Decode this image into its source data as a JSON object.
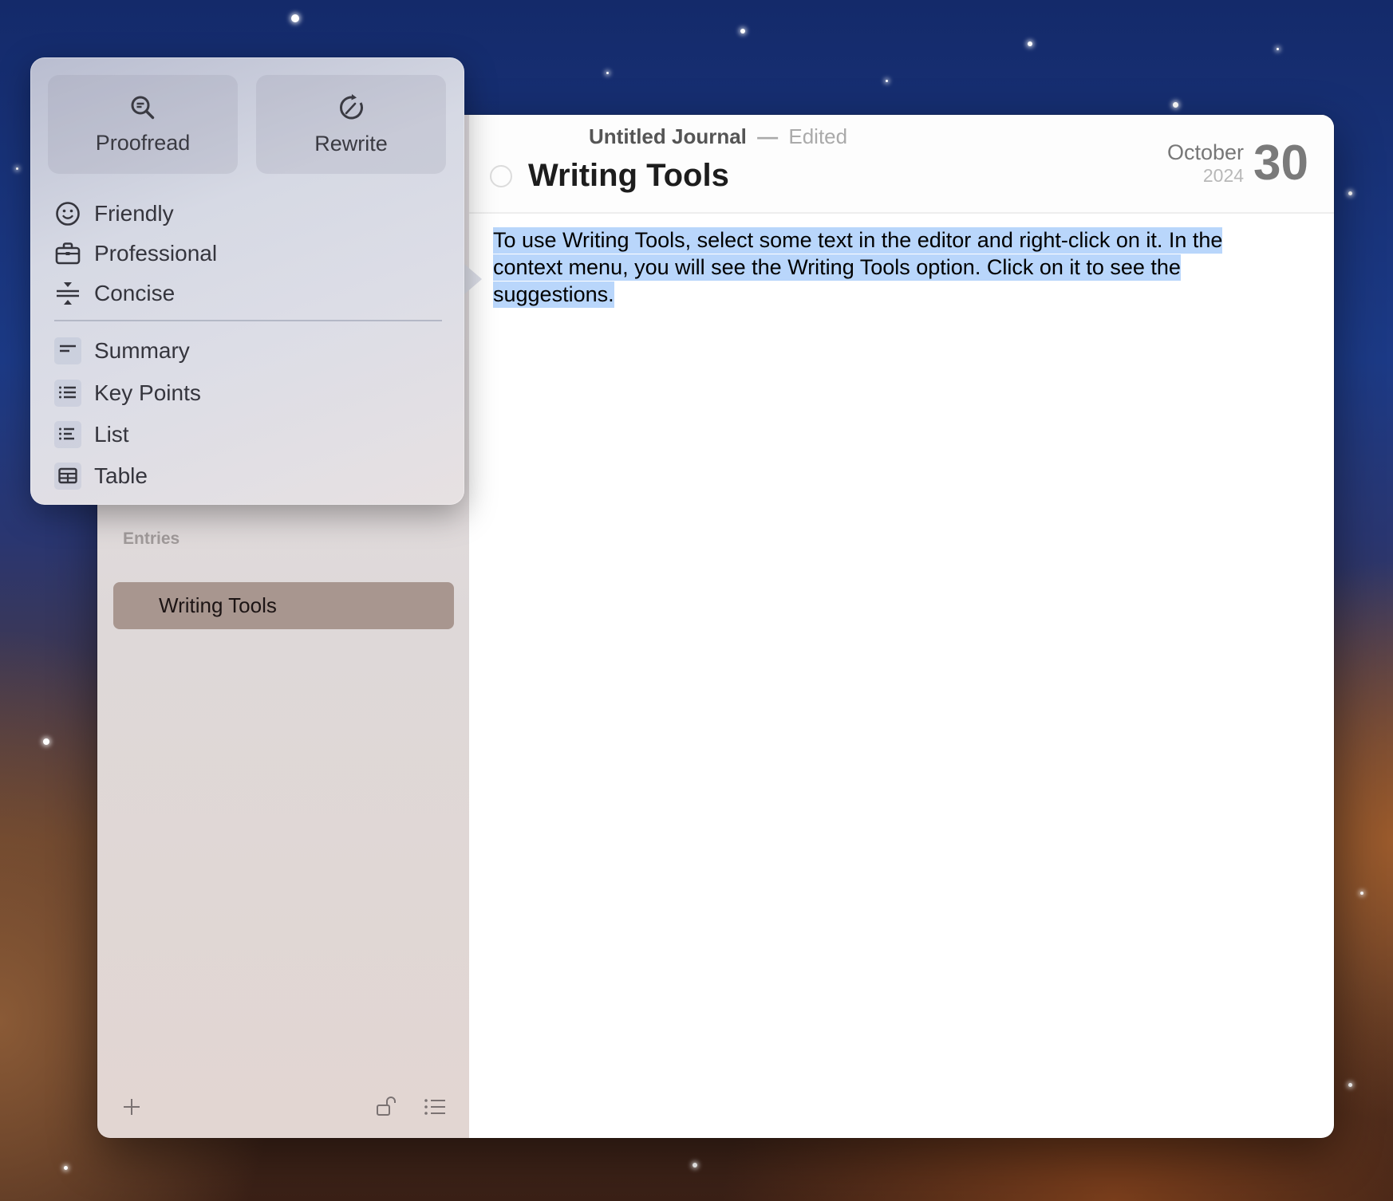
{
  "window": {
    "document_name": "Untitled Journal",
    "title_separator": "—",
    "document_state": "Edited"
  },
  "sidebar": {
    "section_label": "Entries",
    "entries": [
      {
        "label": "Writing Tools",
        "selected": true
      }
    ],
    "toolbar": {
      "add_icon": "plus-icon",
      "lock_icon": "unlock-icon",
      "list_icon": "list-icon"
    }
  },
  "entry": {
    "title": "Writing Tools",
    "date": {
      "month": "October",
      "year": "2024",
      "day": "30"
    },
    "body_selected_text": "To use Writing Tools, select some text in the editor and right-click on it. In the context menu, you will see the Writing Tools option. Click on it to see the suggestions."
  },
  "writing_tools": {
    "primary_actions": [
      {
        "label": "Proofread",
        "icon": "proofread-magnifier-icon"
      },
      {
        "label": "Rewrite",
        "icon": "rewrite-cycle-pencil-icon"
      }
    ],
    "tone_items": [
      {
        "label": "Friendly",
        "icon": "smiley-face-icon"
      },
      {
        "label": "Professional",
        "icon": "briefcase-icon"
      },
      {
        "label": "Concise",
        "icon": "compress-arrows-icon"
      }
    ],
    "format_items": [
      {
        "label": "Summary",
        "icon": "summary-lines-icon"
      },
      {
        "label": "Key Points",
        "icon": "bullet-list-icon"
      },
      {
        "label": "List",
        "icon": "list-icon"
      },
      {
        "label": "Table",
        "icon": "table-icon"
      }
    ]
  },
  "colors": {
    "selection": "#b9d6fb",
    "selected_entry": "#a8968f"
  }
}
